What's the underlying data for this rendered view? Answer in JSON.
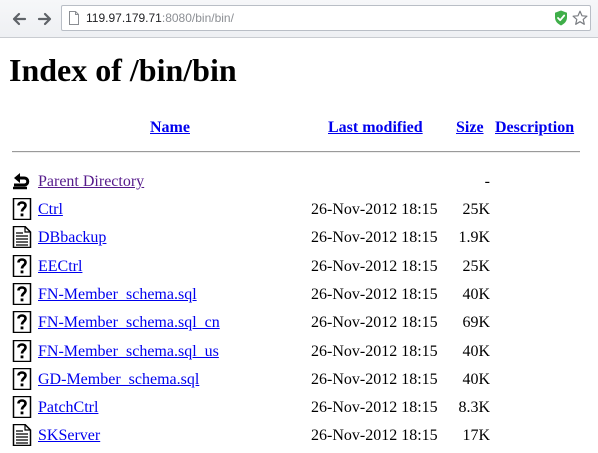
{
  "browser": {
    "url_host": "119.97.179.71",
    "url_rest": ":8080/bin/bin/"
  },
  "page": {
    "title": "Index of /bin/bin",
    "columns": {
      "name": "Name",
      "last_modified": "Last modified",
      "size": "Size",
      "description": "Description"
    },
    "parent": {
      "label": "Parent Directory",
      "size": "-"
    },
    "rows": [
      {
        "name": "Ctrl",
        "modified": "26-Nov-2012 18:15",
        "size": "25K",
        "icon": "unknown-file-icon"
      },
      {
        "name": "DBbackup",
        "modified": "26-Nov-2012 18:15",
        "size": "1.9K",
        "icon": "text-file-icon"
      },
      {
        "name": "EECtrl",
        "modified": "26-Nov-2012 18:15",
        "size": "25K",
        "icon": "unknown-file-icon"
      },
      {
        "name": "FN-Member_schema.sql",
        "modified": "26-Nov-2012 18:15",
        "size": "40K",
        "icon": "unknown-file-icon"
      },
      {
        "name": "FN-Member_schema.sql_cn",
        "modified": "26-Nov-2012 18:15",
        "size": "69K",
        "icon": "unknown-file-icon"
      },
      {
        "name": "FN-Member_schema.sql_us",
        "modified": "26-Nov-2012 18:15",
        "size": "40K",
        "icon": "unknown-file-icon"
      },
      {
        "name": "GD-Member_schema.sql",
        "modified": "26-Nov-2012 18:15",
        "size": "40K",
        "icon": "unknown-file-icon"
      },
      {
        "name": "PatchCtrl",
        "modified": "26-Nov-2012 18:15",
        "size": "8.3K",
        "icon": "unknown-file-icon"
      },
      {
        "name": "SKServer",
        "modified": "26-Nov-2012 18:15",
        "size": "17K",
        "icon": "text-file-icon"
      }
    ]
  }
}
